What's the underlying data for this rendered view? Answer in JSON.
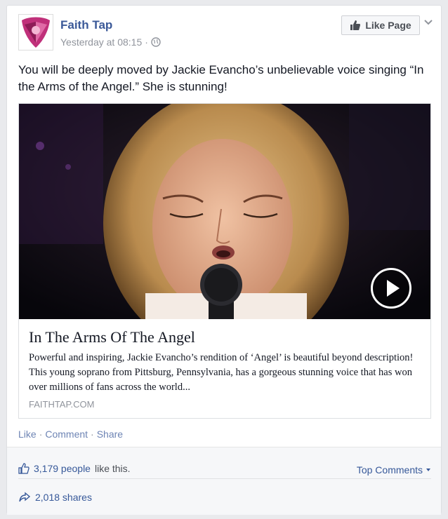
{
  "post": {
    "page_name": "Faith Tap",
    "timestamp": "Yesterday at 08:15",
    "separator": "·",
    "like_page_label": "Like Page",
    "text": "You will be deeply moved by Jackie Evancho’s unbelievable voice singing “In the Arms of the Angel.” She is stunning!"
  },
  "attachment": {
    "title": "In The Arms Of The Angel",
    "description": "Powerful and inspiring, Jackie Evancho’s rendition of ‘Angel’ is beautiful beyond description! This young soprano from Pittsburg, Pennsylvania, has a gorgeous stunning voice that has won over millions of fans across the world...",
    "domain": "FAITHTAP.COM"
  },
  "actions": {
    "like": "Like",
    "comment": "Comment",
    "share": "Share",
    "separator": "·"
  },
  "ufi": {
    "likes_count": "3,179 people",
    "likes_suffix": "like this.",
    "top_comments": "Top Comments",
    "shares": "2,018 shares"
  },
  "icons": {
    "avatar": "faith-tap-logo-icon",
    "globe": "globe-icon",
    "thumbs_up": "thumbs-up-icon",
    "chevron": "chevron-down-icon",
    "play": "play-icon",
    "share": "share-arrow-icon"
  },
  "colors": {
    "link_blue": "#3b5998",
    "muted": "#90949c",
    "logo_pink": "#c0307a"
  }
}
